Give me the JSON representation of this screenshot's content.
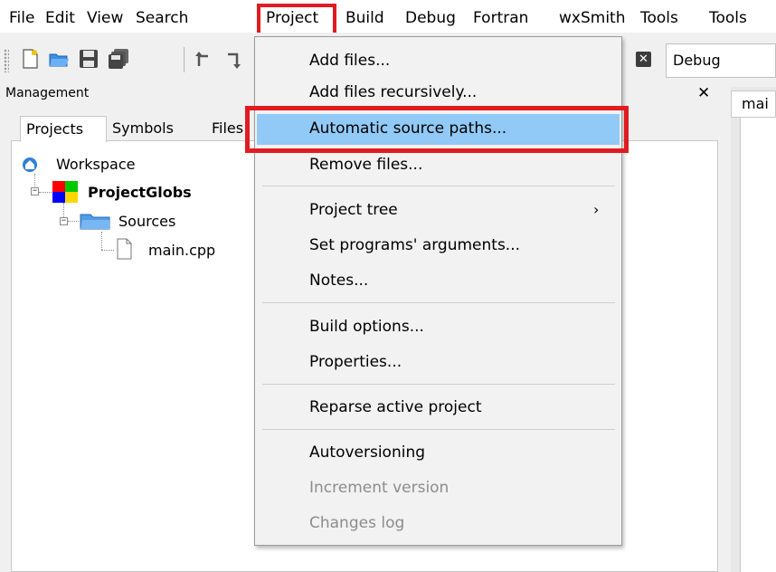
{
  "menubar": {
    "items": [
      "File",
      "Edit",
      "View",
      "Search",
      "Project",
      "Build",
      "Debug",
      "Fortran",
      "wxSmith",
      "Tools",
      "Tools"
    ]
  },
  "toolbar": {
    "target_value": "Debug"
  },
  "management": {
    "title": "Management",
    "tabs": [
      "Projects",
      "Symbols",
      "Files"
    ],
    "tree": {
      "workspace": "Workspace",
      "project": "ProjectGlobs",
      "folder": "Sources",
      "file": "main.cpp"
    }
  },
  "editor": {
    "tab_label": "mai"
  },
  "project_menu": {
    "items": [
      "Add files...",
      "Add files recursively...",
      "Automatic source paths...",
      "Remove files...",
      "Project tree",
      "Set programs' arguments...",
      "Notes...",
      "Build options...",
      "Properties...",
      "Reparse active project",
      "Autoversioning",
      "Increment version",
      "Changes log"
    ],
    "highlighted": "Automatic source paths...",
    "disabled": [
      "Increment version",
      "Changes log"
    ]
  },
  "colors": {
    "highlight_border": "#e11b22",
    "hover_bg": "#91c9f7"
  },
  "icons": {
    "close": "close-icon",
    "submenu": "chevron-right-icon"
  }
}
